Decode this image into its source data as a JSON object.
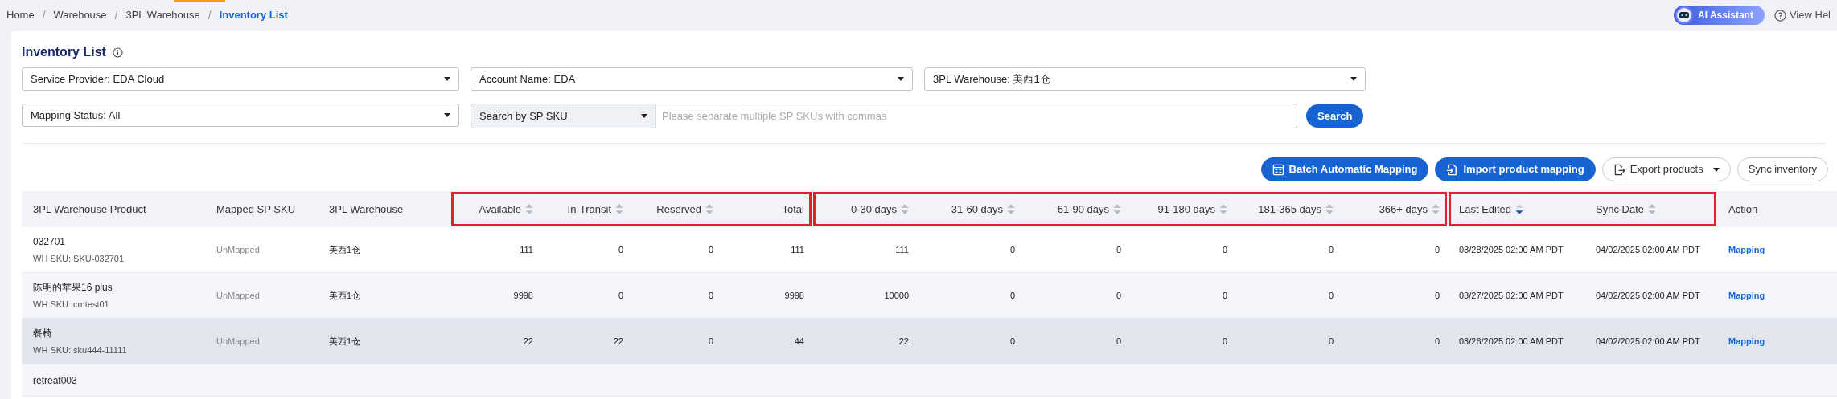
{
  "breadcrumb_separator": "/",
  "breadcrumb": [
    {
      "label": "Home",
      "selected": false
    },
    {
      "label": "Warehouse",
      "selected": false
    },
    {
      "label": "3PL Warehouse",
      "selected": false
    },
    {
      "label": "Inventory List",
      "selected": true
    }
  ],
  "header_actions": {
    "ai_assistant": "AI Assistant",
    "help": "View Hel"
  },
  "title": "Inventory List",
  "filters": [
    {
      "kind": "select",
      "value": "Service Provider: EDA Cloud"
    },
    {
      "kind": "select",
      "value": "Account Name: EDA"
    },
    {
      "kind": "select",
      "value": "3PL Warehouse: 美西1仓"
    },
    {
      "kind": "select",
      "value": "Mapping Status: All"
    }
  ],
  "search": {
    "field": "Search by SP SKU",
    "placeholder": "Please separate multiple SP SKUs with commas",
    "button": "Search"
  },
  "toolbar": [
    {
      "label": "Batch Automatic Mapping",
      "kind": "primary",
      "menu": false
    },
    {
      "label": "Import product mapping",
      "kind": "primary",
      "menu": false
    },
    {
      "label": "Export products",
      "kind": "secondary",
      "menu": true
    },
    {
      "label": "Sync inventory",
      "kind": "secondary",
      "menu": false
    }
  ],
  "table": {
    "column_groups": [
      {
        "highlighted": false,
        "columns": [
          {
            "label": "3PL Warehouse Product",
            "kind": "text",
            "sortable": false
          },
          {
            "label": "Mapped SP SKU",
            "kind": "text",
            "sortable": false
          },
          {
            "label": "3PL Warehouse",
            "kind": "text",
            "sortable": false
          }
        ]
      },
      {
        "highlighted": true,
        "columns": [
          {
            "label": "Available",
            "kind": "number",
            "sortable": true,
            "sorted": false
          },
          {
            "label": "In-Transit",
            "kind": "number",
            "sortable": true,
            "sorted": false
          },
          {
            "label": "Reserved",
            "kind": "number",
            "sortable": true,
            "sorted": false
          },
          {
            "label": "Total",
            "kind": "number",
            "sortable": false
          }
        ]
      },
      {
        "highlighted": true,
        "columns": [
          {
            "label": "0-30 days",
            "kind": "number",
            "sortable": true,
            "sorted": false
          },
          {
            "label": "31-60 days",
            "kind": "number",
            "sortable": true,
            "sorted": false
          },
          {
            "label": "61-90 days",
            "kind": "number",
            "sortable": true,
            "sorted": false
          },
          {
            "label": "91-180 days",
            "kind": "number",
            "sortable": true,
            "sorted": false
          },
          {
            "label": "181-365 days",
            "kind": "number",
            "sortable": true,
            "sorted": false
          },
          {
            "label": "366+ days",
            "kind": "number",
            "sortable": true,
            "sorted": false
          }
        ]
      },
      {
        "highlighted": true,
        "columns": [
          {
            "label": "Last Edited",
            "kind": "text",
            "sortable": true,
            "sorted": true
          },
          {
            "label": "Sync Date",
            "kind": "text",
            "sortable": true,
            "sorted": false
          }
        ]
      },
      {
        "highlighted": false,
        "columns": [
          {
            "label": "Action",
            "kind": "action",
            "sortable": false
          }
        ]
      }
    ],
    "rows": [
      {
        "hovered": false,
        "product": "032701",
        "wh_sku": "WH SKU: SKU-032701",
        "cells": [
          "UnMapped",
          "美西1仓",
          "111",
          "0",
          "0",
          "111",
          "111",
          "0",
          "0",
          "0",
          "0",
          "0",
          "03/28/2025 02:00 AM PDT",
          "04/02/2025 02:00 AM PDT",
          "Mapping"
        ]
      },
      {
        "hovered": false,
        "product": "陈明的苹果16 plus",
        "wh_sku": "WH SKU: cmtest01",
        "cells": [
          "UnMapped",
          "美西1仓",
          "9998",
          "0",
          "0",
          "9998",
          "10000",
          "0",
          "0",
          "0",
          "0",
          "0",
          "03/27/2025 02:00 AM PDT",
          "04/02/2025 02:00 AM PDT",
          "Mapping"
        ]
      },
      {
        "hovered": true,
        "product": "餐椅",
        "wh_sku": "WH SKU: sku444-11111",
        "cells": [
          "UnMapped",
          "美西1仓",
          "22",
          "22",
          "0",
          "44",
          "22",
          "0",
          "0",
          "0",
          "0",
          "0",
          "03/26/2025 02:00 AM PDT",
          "04/02/2025 02:00 AM PDT",
          "Mapping"
        ]
      },
      {
        "hovered": false,
        "product": "retreat003"
      }
    ]
  }
}
